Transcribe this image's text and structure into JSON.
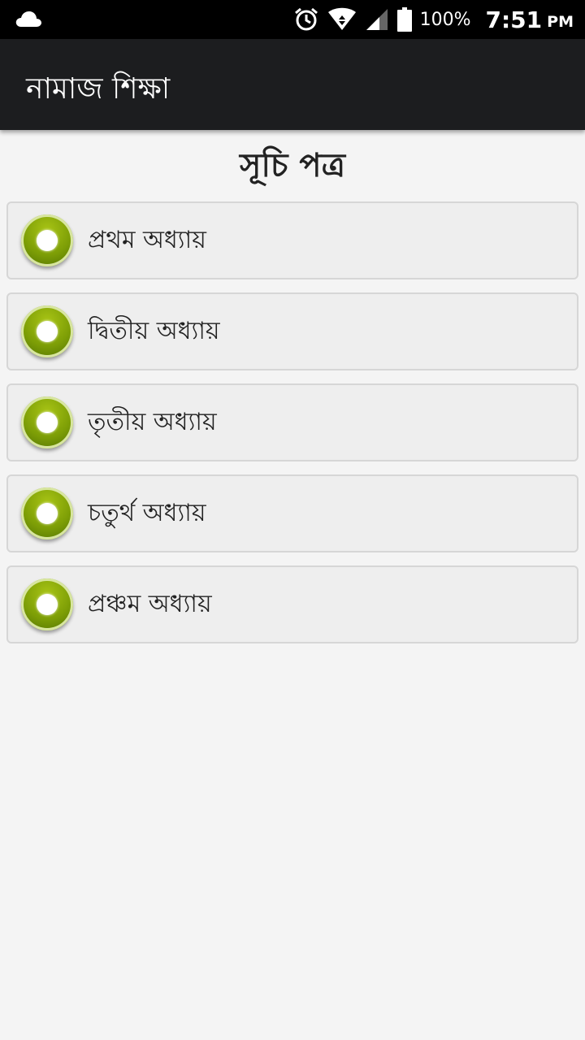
{
  "status_bar": {
    "battery_percent": "100%",
    "time": "7:51",
    "ampm": "PM",
    "icons": [
      "cloud-icon",
      "alarm-icon",
      "wifi-icon",
      "signal-icon",
      "battery-icon"
    ]
  },
  "app_bar": {
    "title": "নামাজ শিক্ষা"
  },
  "main": {
    "heading": "সূচি পত্র",
    "chapters": [
      {
        "label": "প্রথম অধ্যায়"
      },
      {
        "label": "দ্বিতীয় অধ্যায়"
      },
      {
        "label": "তৃতীয় অধ্যায়"
      },
      {
        "label": "চতুর্থ অধ্যায়"
      },
      {
        "label": "প্রঞ্চম অধ্যায়"
      }
    ]
  },
  "colors": {
    "app_bar": "#1c1d1f",
    "background": "#f4f4f4",
    "bullet": "#7d9e06"
  }
}
